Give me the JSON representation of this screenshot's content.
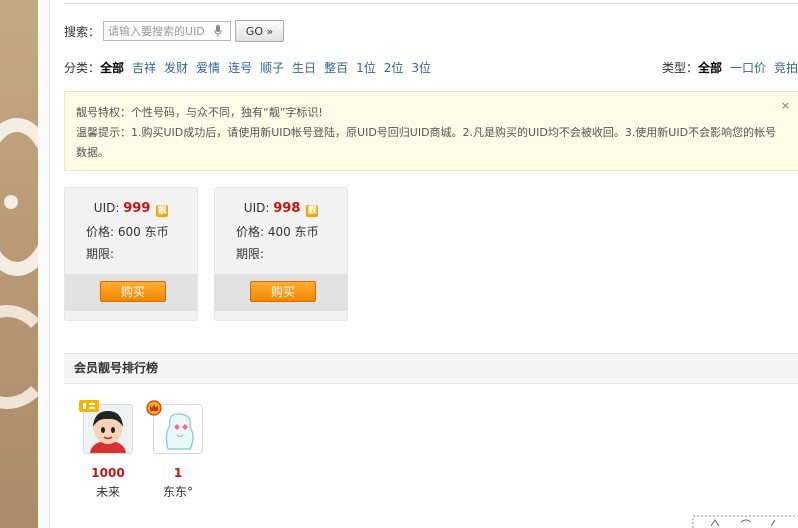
{
  "search": {
    "label": "搜索：",
    "placeholder": "请输入要搜索的UID",
    "go_label": "GO »"
  },
  "categories": {
    "label": "分类：",
    "items": [
      "全部",
      "吉祥",
      "发财",
      "爱情",
      "连号",
      "顺子",
      "生日",
      "整百",
      "1位",
      "2位",
      "3位"
    ],
    "active": "全部"
  },
  "types": {
    "label": "类型：",
    "items": [
      "全部",
      "一口价",
      "竞拍"
    ],
    "active": "全部"
  },
  "notice": {
    "line1": "靓号特权：个性号码，与众不同，独有“靓”字标识!",
    "line2": "温馨提示：1.购买UID成功后，请使用新UID帐号登陆，原UID号回归UID商城。2.凡是购买的UID均不会被收回。3.使用新UID不会影响您的帐号数据。",
    "close_icon": "×"
  },
  "cards": [
    {
      "uid_label": "UID:",
      "uid": "999",
      "badge": "靓",
      "price_label": "价格:",
      "price": "600 东币",
      "expire_label": "期限:",
      "buy_label": "购买"
    },
    {
      "uid_label": "UID:",
      "uid": "998",
      "badge": "靓",
      "price_label": "价格:",
      "price": "400 东币",
      "expire_label": "期限:",
      "buy_label": "购买"
    }
  ],
  "ranking": {
    "title": "会员靓号排行榜",
    "members": [
      {
        "count": "1000",
        "name": "未来",
        "badge_icon": "liang-badge-icon",
        "avatar_icon": "cartoon-boy-avatar"
      },
      {
        "count": "1",
        "name": "东东°",
        "badge_icon": "crown-badge-icon",
        "avatar_icon": "cartoon-face-avatar"
      }
    ]
  },
  "colors": {
    "accent_red": "#c81212",
    "link_blue": "#336699",
    "buy_orange": "#f28600",
    "notice_bg": "#fffbe6"
  }
}
